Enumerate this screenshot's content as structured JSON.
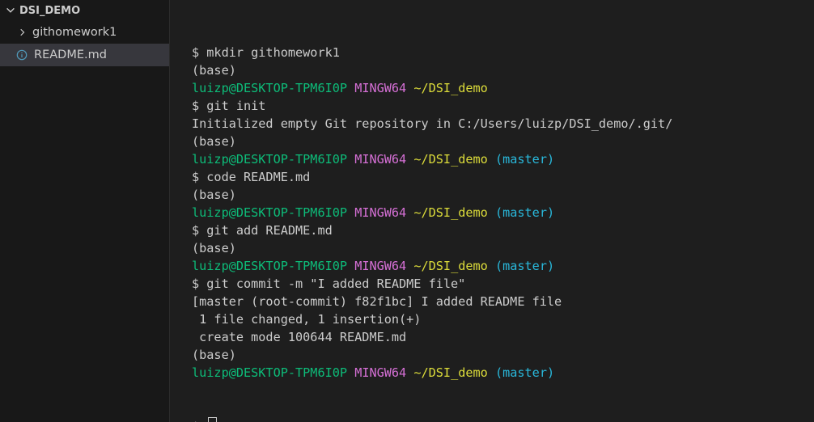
{
  "explorer": {
    "folder": "DSI_DEMO",
    "items": [
      {
        "label": "githomework1",
        "type": "folder"
      },
      {
        "label": "README.md",
        "type": "file"
      }
    ]
  },
  "terminal": {
    "lines": [
      {
        "kind": "cmd",
        "text": "$ mkdir githomework1"
      },
      {
        "kind": "out",
        "text": "(base)"
      },
      {
        "kind": "prompt",
        "user": "luizp@DESKTOP-TPM6I0P",
        "sys": "MINGW64",
        "path": "~/DSI_demo",
        "branch": ""
      },
      {
        "kind": "cmd",
        "text": "$ git init"
      },
      {
        "kind": "out",
        "text": "Initialized empty Git repository in C:/Users/luizp/DSI_demo/.git/"
      },
      {
        "kind": "out",
        "text": "(base)"
      },
      {
        "kind": "prompt",
        "user": "luizp@DESKTOP-TPM6I0P",
        "sys": "MINGW64",
        "path": "~/DSI_demo",
        "branch": "(master)"
      },
      {
        "kind": "cmd",
        "text": "$ code README.md"
      },
      {
        "kind": "out",
        "text": "(base)"
      },
      {
        "kind": "prompt",
        "user": "luizp@DESKTOP-TPM6I0P",
        "sys": "MINGW64",
        "path": "~/DSI_demo",
        "branch": "(master)"
      },
      {
        "kind": "cmd",
        "text": "$ git add README.md"
      },
      {
        "kind": "out",
        "text": "(base)"
      },
      {
        "kind": "prompt",
        "user": "luizp@DESKTOP-TPM6I0P",
        "sys": "MINGW64",
        "path": "~/DSI_demo",
        "branch": "(master)"
      },
      {
        "kind": "cmd",
        "text": "$ git commit -m \"I added README file\""
      },
      {
        "kind": "out",
        "text": "[master (root-commit) f82f1bc] I added README file"
      },
      {
        "kind": "out",
        "text": " 1 file changed, 1 insertion(+)"
      },
      {
        "kind": "out",
        "text": " create mode 100644 README.md"
      },
      {
        "kind": "out",
        "text": "(base)"
      },
      {
        "kind": "prompt",
        "user": "luizp@DESKTOP-TPM6I0P",
        "sys": "MINGW64",
        "path": "~/DSI_demo",
        "branch": "(master)"
      }
    ],
    "input_prompt": "$"
  }
}
